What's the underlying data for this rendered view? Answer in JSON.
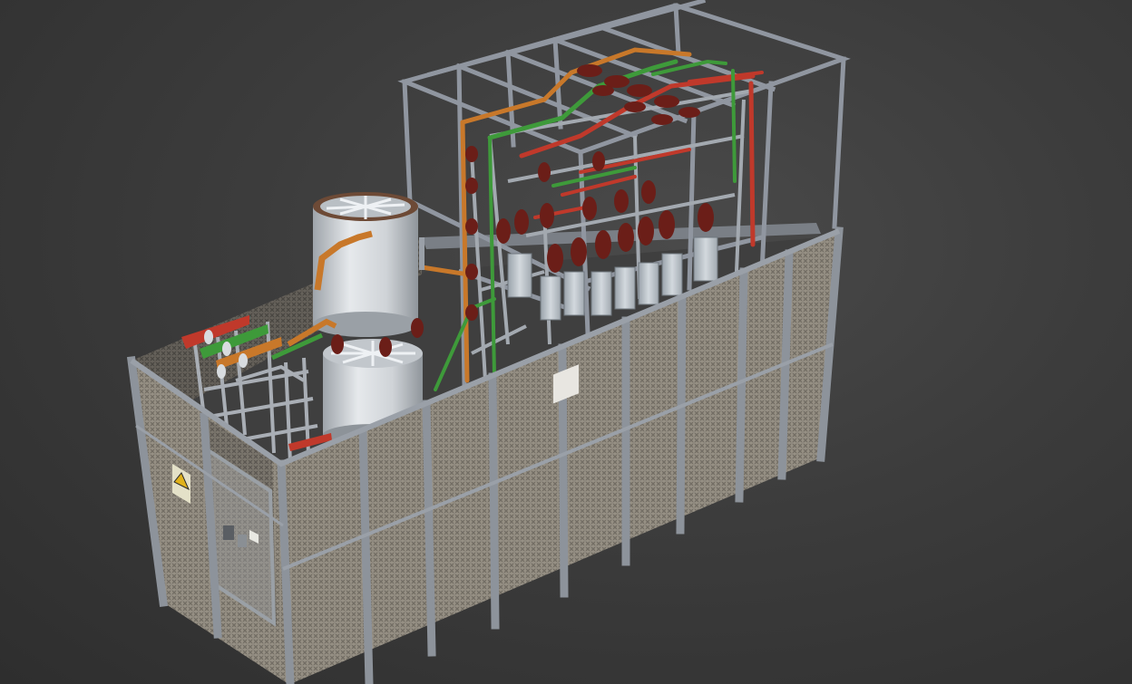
{
  "viewport": {
    "background_color": "#3c3c3c",
    "kind": "3d-render-viewport"
  },
  "model": {
    "subject": "outdoor-substation-enclosure",
    "colors": {
      "mesh_panel": "#8f8a80",
      "frame_steel": "#8a9098",
      "reactor_body": "#d5d9dd",
      "insulator": "#6b1e18",
      "busbar_red": "#c0392b",
      "busbar_green": "#3e9a3a",
      "busbar_orange": "#c8782a",
      "capacitor_unit": "#c9d0d6"
    },
    "icons": {
      "warning_sign": "warning-triangle-icon",
      "panel_sign": "nameplate-icon"
    }
  }
}
